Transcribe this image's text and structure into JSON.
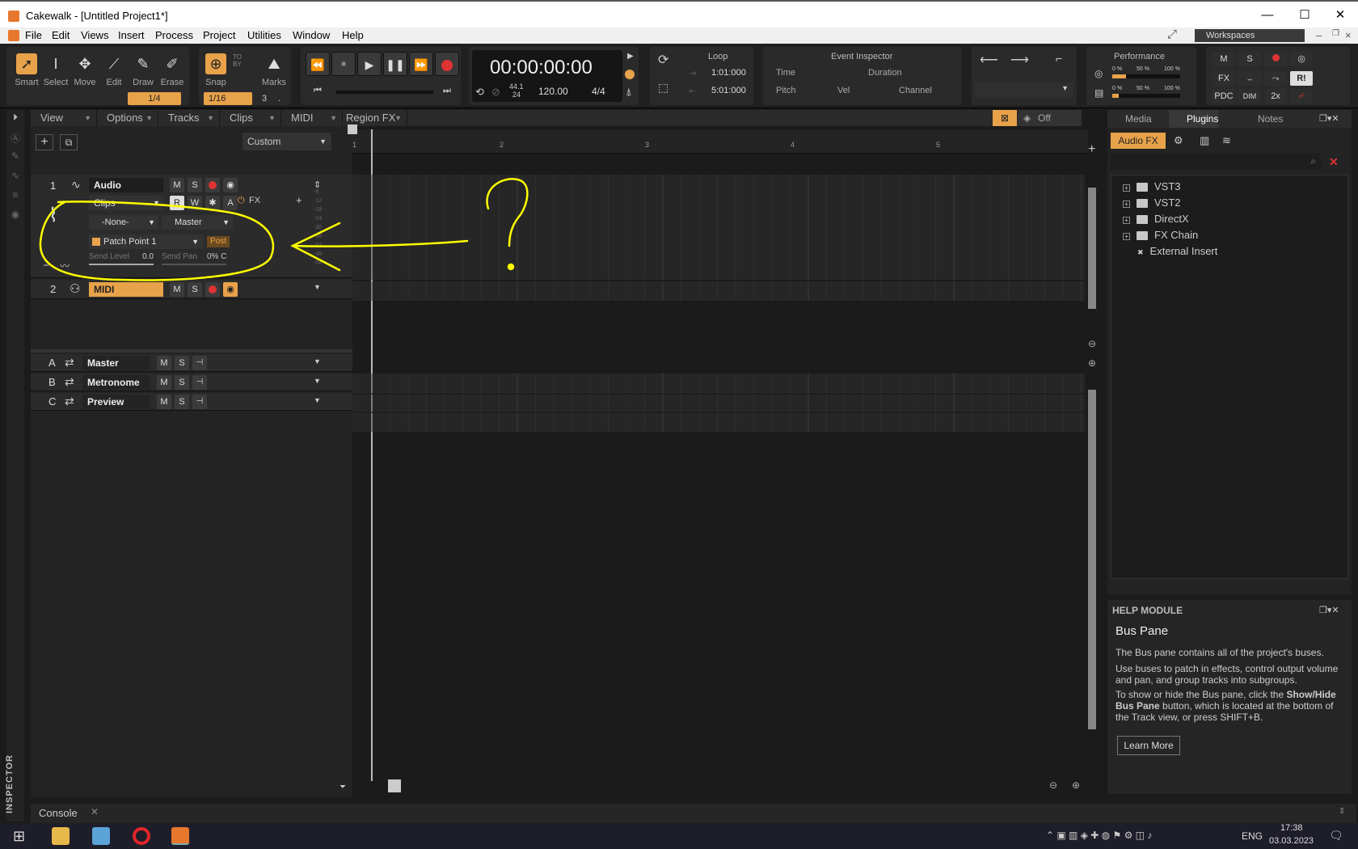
{
  "window": {
    "title": "Cakewalk - [Untitled Project1*]",
    "minimize": "—",
    "maximize": "☐",
    "close": "✕"
  },
  "menu": [
    "File",
    "Edit",
    "Views",
    "Insert",
    "Process",
    "Project",
    "Utilities",
    "Window",
    "Help"
  ],
  "workspaces": "Workspaces",
  "tools": {
    "smart": "Smart",
    "select": "Select",
    "move": "Move",
    "edit": "Edit",
    "draw": "Draw",
    "erase": "Erase",
    "snap": "Snap",
    "marks": "Marks",
    "tool_res": "1/4",
    "snap_res": "1/16",
    "snap_by": "TO\nBY",
    "snap_num": "3"
  },
  "transport": {
    "time": "00:00:00:00",
    "sample_rate": "44.1",
    "bit_depth": "24",
    "tempo": "120.00",
    "meter": "4/4"
  },
  "loop": {
    "title": "Loop",
    "start": "1:01:000",
    "end": "5:01:000"
  },
  "event_inspector": {
    "title": "Event Inspector",
    "time": "Time",
    "duration": "Duration",
    "pitch": "Pitch",
    "vel": "Vel",
    "channel": "Channel"
  },
  "performance": {
    "title": "Performance",
    "cpu1": "0 %",
    "cpu2": "50 %",
    "cpu3": "100 %",
    "cpu_level": 0.2,
    "disk_level": 0.1
  },
  "mix": {
    "m": "M",
    "s": "S",
    "fx": "FX",
    "pdc": "PDC",
    "dim": "DIM",
    "x2": "2x",
    "ri": "R!"
  },
  "trackmenu": [
    "View",
    "Options",
    "Tracks",
    "Clips",
    "MIDI",
    "Region FX"
  ],
  "trackview": {
    "preset": "Custom",
    "snap_state": "Off"
  },
  "ruler": [
    "1",
    "2",
    "3",
    "4",
    "5"
  ],
  "tracks": [
    {
      "num": "1",
      "name": "Audio",
      "m": "M",
      "s": "S",
      "view": "Clips",
      "r": "R",
      "w": "W",
      "a": "A",
      "fx": "FX",
      "input": "-None-",
      "output": "Master",
      "patch": "Patch Point 1",
      "post": "Post",
      "send_level_label": "Send Level",
      "send_level": "0.0",
      "send_pan_label": "Send Pan",
      "send_pan": "0% C"
    },
    {
      "num": "2",
      "name": "MIDI",
      "m": "M",
      "s": "S"
    }
  ],
  "meter_scale": [
    "-6",
    "-12",
    "-18",
    "-24",
    "-30",
    "-36",
    "-42",
    "-48",
    "-54"
  ],
  "buses": [
    {
      "letter": "A",
      "name": "Master",
      "m": "M",
      "s": "S"
    },
    {
      "letter": "B",
      "name": "Metronome",
      "m": "M",
      "s": "S"
    },
    {
      "letter": "C",
      "name": "Preview",
      "m": "M",
      "s": "S"
    }
  ],
  "inspector_label": "INSPECTOR",
  "browser": {
    "tabs": [
      "Media",
      "Plugins",
      "Notes"
    ],
    "audiofx": "Audio FX",
    "tree": [
      "VST3",
      "VST2",
      "DirectX",
      "FX Chain",
      "External Insert"
    ]
  },
  "help": {
    "header": "HELP MODULE",
    "title": "Bus Pane",
    "p1": "The Bus pane contains all of the project's buses.",
    "p2": "Use buses to patch in effects, control output volume and pan, and group tracks into subgroups.",
    "p3_a": "To show or hide the Bus pane, click the ",
    "p3_b": "Show/Hide Bus Pane",
    "p3_c": " button, which is located at the bottom of the Track view, or press SHIFT+B.",
    "learn_more": "Learn More"
  },
  "console": "Console",
  "taskbar": {
    "lang": "ENG",
    "time": "17:38",
    "date": "03.03.2023"
  },
  "colors": {
    "accent": "#e8a24a",
    "record": "#d33333",
    "annotation": "#ffff00"
  }
}
